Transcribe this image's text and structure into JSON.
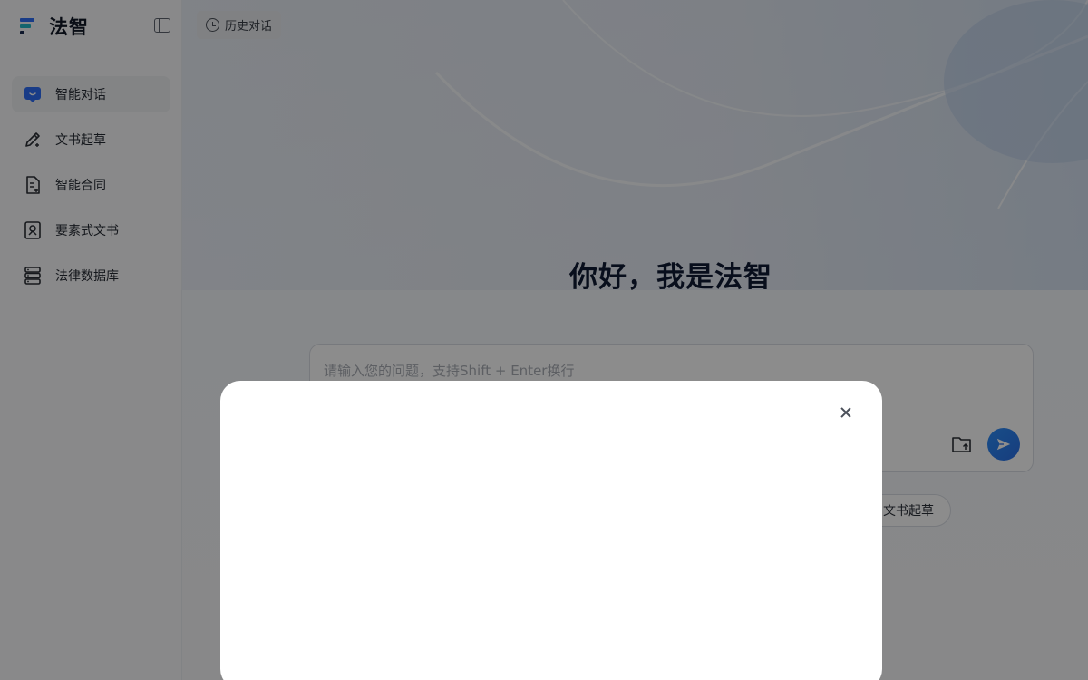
{
  "app": {
    "name": "法智"
  },
  "sidebar": {
    "items": [
      {
        "label": "智能对话",
        "icon": "chat-bubble-icon",
        "active": true
      },
      {
        "label": "文书起草",
        "icon": "pen-edit-icon",
        "active": false
      },
      {
        "label": "智能合同",
        "icon": "contract-doc-icon",
        "active": false
      },
      {
        "label": "要素式文书",
        "icon": "element-doc-icon",
        "active": false
      },
      {
        "label": "法律数据库",
        "icon": "database-icon",
        "active": false
      }
    ]
  },
  "header": {
    "history_label": "历史对话"
  },
  "main": {
    "greeting": "你好，我是法智",
    "input_placeholder": "请输入您的问题，支持Shift + Enter换行",
    "chips": [
      "文书起草"
    ]
  },
  "colors": {
    "accent": "#2a6fe6",
    "brand_blue": "#2f6df6",
    "brand_teal": "#24b6c9",
    "overlay": "rgba(0,0,0,0.45)"
  },
  "modal": {
    "visible": true,
    "close_icon": "close-icon"
  }
}
